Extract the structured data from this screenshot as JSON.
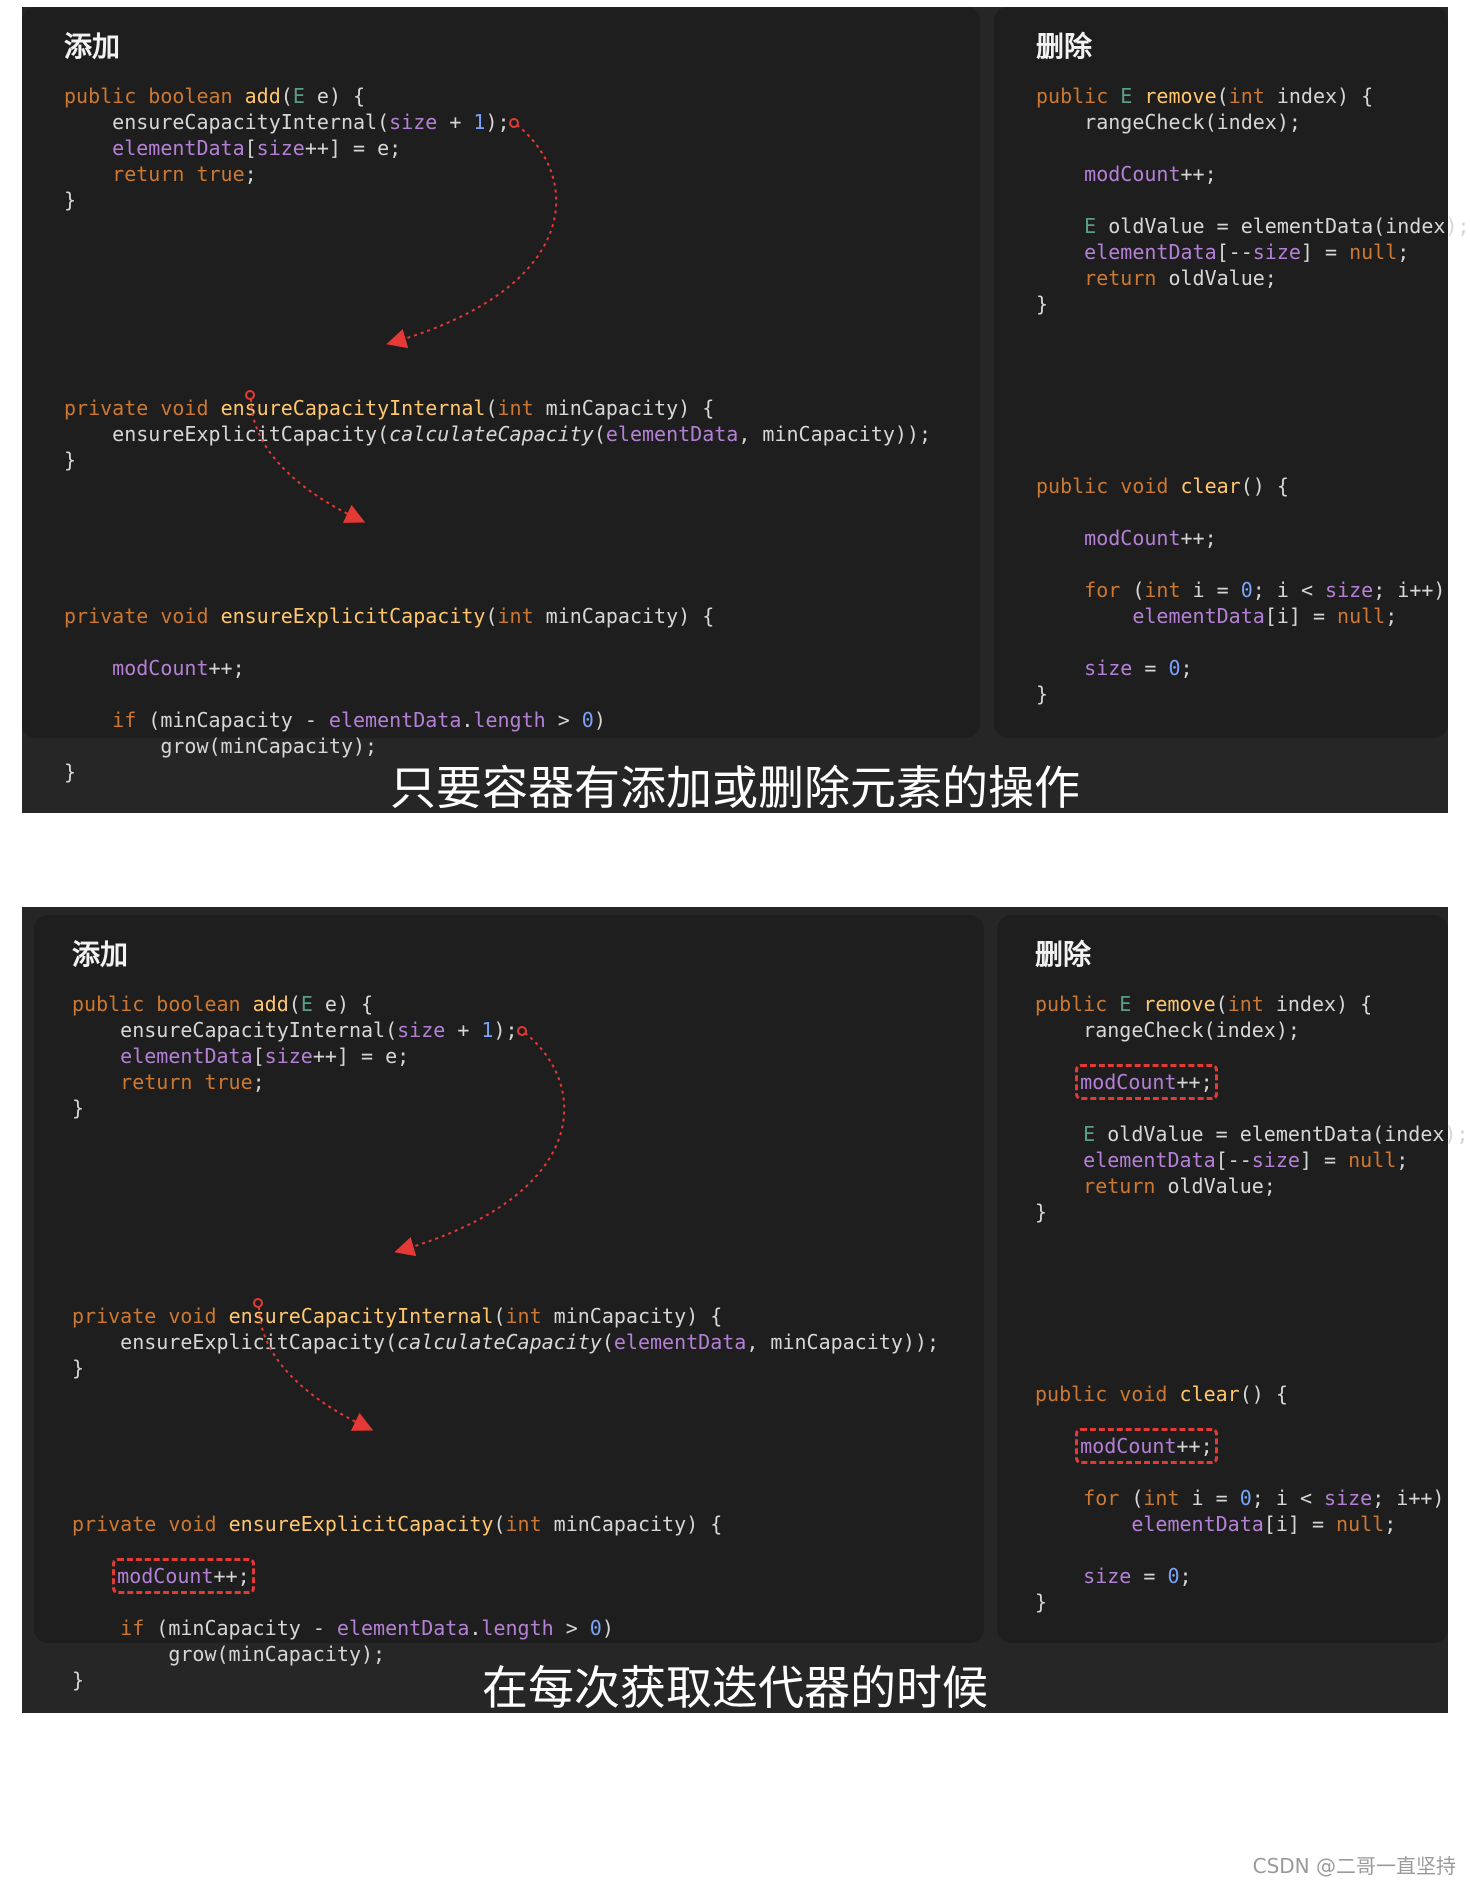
{
  "frames": [
    {
      "left_title": "添加",
      "right_title": "删除",
      "subtitle": "只要容器有添加或删除元素的操作"
    },
    {
      "left_title": "添加",
      "right_title": "删除",
      "subtitle": "在每次获取迭代器的时候"
    }
  ],
  "code_tokens": {
    "kw_public": "public",
    "kw_private": "private",
    "kw_boolean": "boolean",
    "kw_void": "void",
    "kw_return": "return",
    "kw_true": "true",
    "kw_int": "int",
    "kw_if": "if",
    "kw_for": "for",
    "kw_null": "null",
    "type_E": "E",
    "fn_add": "add",
    "fn_ensure_capacity_internal": "ensureCapacityInternal",
    "fn_ensure_explicit_capacity": "ensureExplicitCapacity",
    "fn_calculate_capacity": "calculateCapacity",
    "fn_remove": "remove",
    "fn_clear": "clear",
    "call_range_check": "rangeCheck",
    "call_grow": "grow",
    "var_size": "size",
    "var_element_data": "elementData",
    "var_mod_count": "modCount",
    "num_0": "0",
    "num_1": "1"
  },
  "colors": {
    "keyword": "#cc7832",
    "function": "#ffc66d",
    "field": "#b480d6",
    "number": "#7aa2f7",
    "arrow": "#e53935",
    "highlight_border": "#e53935"
  },
  "watermark": "CSDN @二哥一直坚持"
}
